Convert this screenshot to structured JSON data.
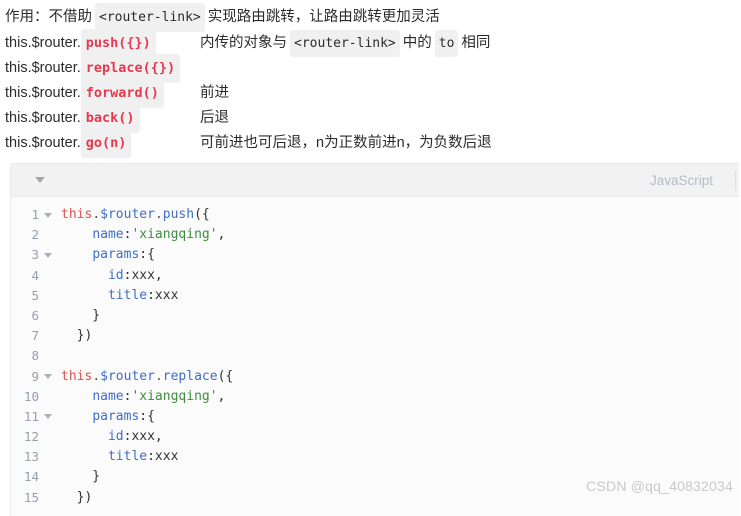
{
  "notes": {
    "intro": {
      "prefix": "作用：不借助",
      "code": "<router-link>",
      "suffix": "实现路由跳转，让路由跳转更加灵活"
    },
    "rows": [
      {
        "receiver": "this.$router.",
        "api": "push({})",
        "desc_prefix": "内传的对象与",
        "desc_code1": "<router-link>",
        "desc_middle": "中的",
        "desc_code2": "to",
        "desc_suffix": "相同"
      },
      {
        "receiver": "this.$router.",
        "api": "replace({})",
        "desc_prefix": "",
        "desc_code1": "",
        "desc_middle": "",
        "desc_code2": "",
        "desc_suffix": ""
      },
      {
        "receiver": "this.$router.",
        "api": "forward()",
        "desc_plain": "前进"
      },
      {
        "receiver": "this.$router.",
        "api": "back()",
        "desc_plain": "后退"
      },
      {
        "receiver": "this.$router.",
        "api": "go(n)",
        "desc_plain": "可前进也可后退，n为正数前进n，为负数后退"
      }
    ]
  },
  "code_block": {
    "language_label": "JavaScript",
    "collapse_icon": "triangle-down-icon",
    "lines": [
      {
        "n": "1",
        "fold": true,
        "tokens": [
          {
            "t": "this",
            "c": "kw"
          },
          {
            "t": ".",
            "c": "punct"
          },
          {
            "t": "$router",
            "c": "var"
          },
          {
            "t": ".",
            "c": "punct"
          },
          {
            "t": "push",
            "c": "fn"
          },
          {
            "t": "({",
            "c": "plain"
          }
        ]
      },
      {
        "n": "2",
        "fold": false,
        "tokens": [
          {
            "t": "    ",
            "c": "plain"
          },
          {
            "t": "name",
            "c": "prop"
          },
          {
            "t": ":",
            "c": "plain"
          },
          {
            "t": "'xiangqing'",
            "c": "str"
          },
          {
            "t": ",",
            "c": "plain"
          }
        ]
      },
      {
        "n": "3",
        "fold": true,
        "tokens": [
          {
            "t": "    ",
            "c": "plain"
          },
          {
            "t": "params",
            "c": "prop"
          },
          {
            "t": ":{",
            "c": "plain"
          }
        ]
      },
      {
        "n": "4",
        "fold": false,
        "tokens": [
          {
            "t": "      ",
            "c": "plain"
          },
          {
            "t": "id",
            "c": "prop"
          },
          {
            "t": ":xxx,",
            "c": "plain"
          }
        ]
      },
      {
        "n": "5",
        "fold": false,
        "tokens": [
          {
            "t": "      ",
            "c": "plain"
          },
          {
            "t": "title",
            "c": "prop"
          },
          {
            "t": ":xxx",
            "c": "plain"
          }
        ]
      },
      {
        "n": "6",
        "fold": false,
        "tokens": [
          {
            "t": "    }",
            "c": "plain"
          }
        ]
      },
      {
        "n": "7",
        "fold": false,
        "tokens": [
          {
            "t": "  })",
            "c": "plain"
          }
        ]
      },
      {
        "n": "8",
        "fold": false,
        "tokens": [
          {
            "t": "",
            "c": "plain"
          }
        ]
      },
      {
        "n": "9",
        "fold": true,
        "tokens": [
          {
            "t": "this",
            "c": "kw"
          },
          {
            "t": ".",
            "c": "punct"
          },
          {
            "t": "$router",
            "c": "var"
          },
          {
            "t": ".",
            "c": "punct"
          },
          {
            "t": "replace",
            "c": "fn"
          },
          {
            "t": "({",
            "c": "plain"
          }
        ]
      },
      {
        "n": "10",
        "fold": false,
        "tokens": [
          {
            "t": "    ",
            "c": "plain"
          },
          {
            "t": "name",
            "c": "prop"
          },
          {
            "t": ":",
            "c": "plain"
          },
          {
            "t": "'xiangqing'",
            "c": "str"
          },
          {
            "t": ",",
            "c": "plain"
          }
        ]
      },
      {
        "n": "11",
        "fold": true,
        "tokens": [
          {
            "t": "    ",
            "c": "plain"
          },
          {
            "t": "params",
            "c": "prop"
          },
          {
            "t": ":{",
            "c": "plain"
          }
        ]
      },
      {
        "n": "12",
        "fold": false,
        "tokens": [
          {
            "t": "      ",
            "c": "plain"
          },
          {
            "t": "id",
            "c": "prop"
          },
          {
            "t": ":xxx,",
            "c": "plain"
          }
        ]
      },
      {
        "n": "13",
        "fold": false,
        "tokens": [
          {
            "t": "      ",
            "c": "plain"
          },
          {
            "t": "title",
            "c": "prop"
          },
          {
            "t": ":xxx",
            "c": "plain"
          }
        ]
      },
      {
        "n": "14",
        "fold": false,
        "tokens": [
          {
            "t": "    }",
            "c": "plain"
          }
        ]
      },
      {
        "n": "15",
        "fold": false,
        "tokens": [
          {
            "t": "  })",
            "c": "plain"
          }
        ]
      }
    ]
  },
  "watermark": "CSDN @qq_40832034",
  "colors": {
    "api_badge_text": "#e8384f",
    "inline_code_bg": "#f0f0f0",
    "code_header_bg": "#f2f2f2",
    "code_body_bg": "#fbfbfb",
    "keyword": "#d9544d",
    "property": "#3e6ec7",
    "string": "#3f8c3f",
    "line_number": "#96a0ad",
    "lang_label": "#b6bac6",
    "watermark": "#c9c9c9"
  }
}
